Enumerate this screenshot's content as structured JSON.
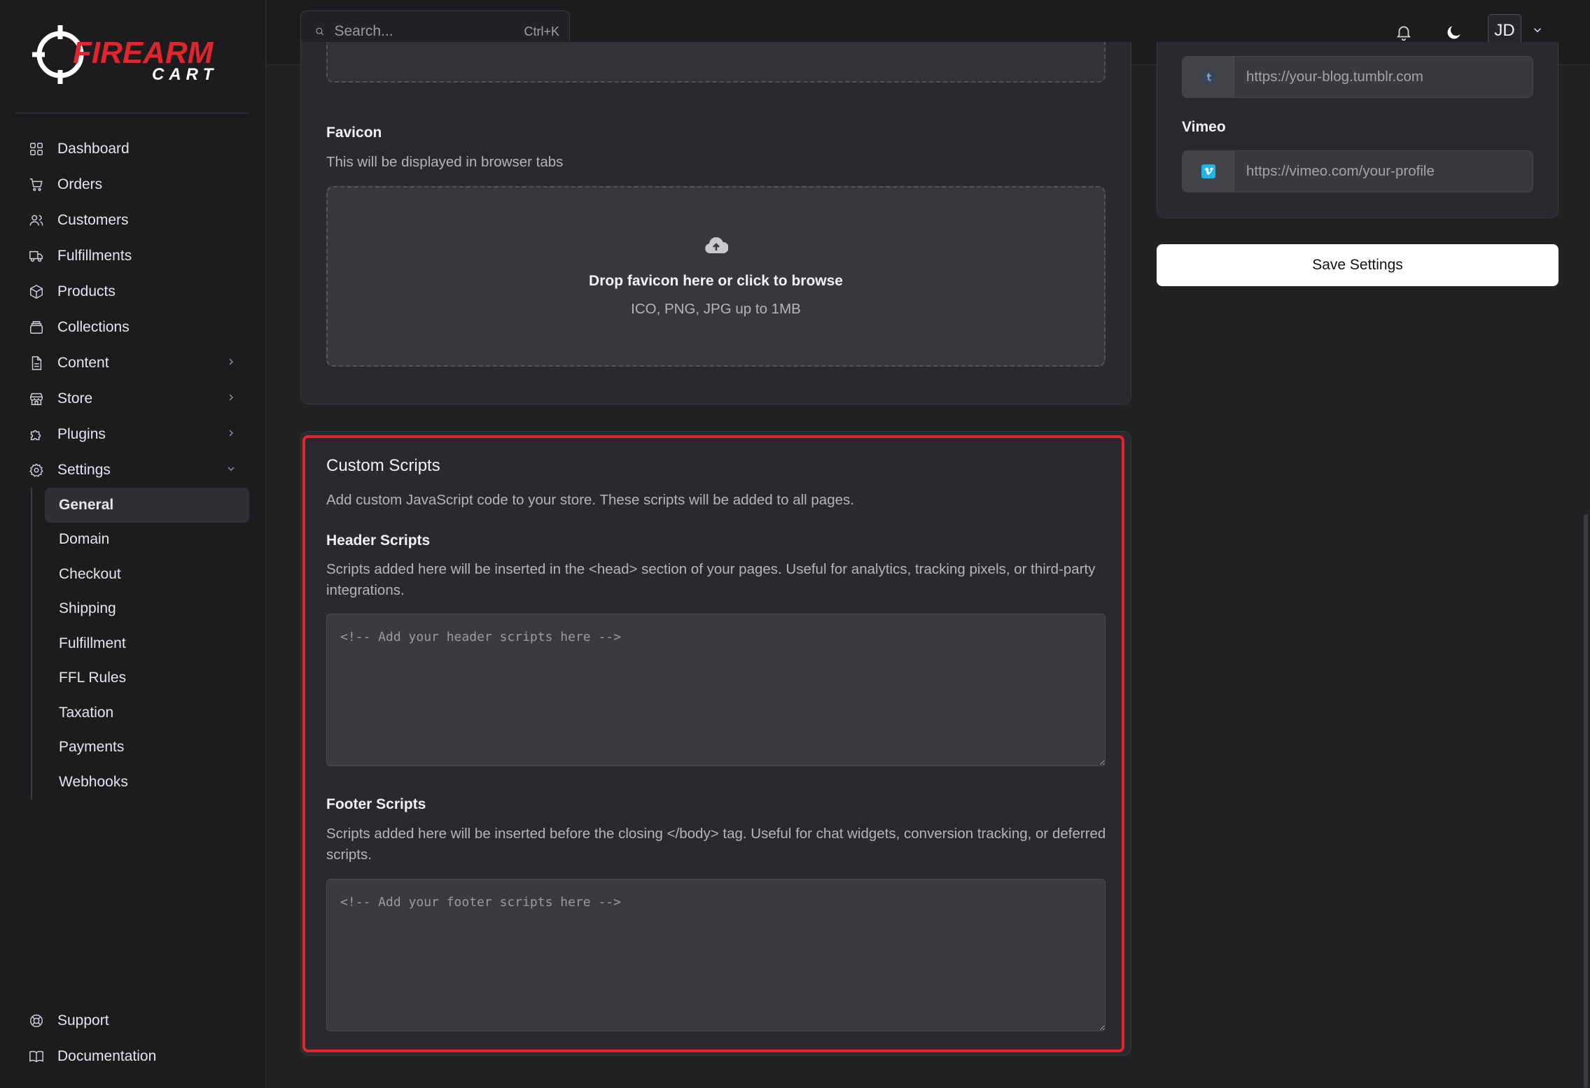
{
  "brand": {
    "line1": "FIREARM",
    "line2": "CART",
    "accent": "#e0252c"
  },
  "search": {
    "placeholder": "Search...",
    "shortcut": "Ctrl+K"
  },
  "header": {
    "avatar_initials": "JD"
  },
  "sidebar": {
    "items": [
      {
        "label": "Dashboard",
        "icon": "dashboard-icon"
      },
      {
        "label": "Orders",
        "icon": "cart-icon"
      },
      {
        "label": "Customers",
        "icon": "users-icon"
      },
      {
        "label": "Fulfillments",
        "icon": "truck-icon"
      },
      {
        "label": "Products",
        "icon": "box-icon"
      },
      {
        "label": "Collections",
        "icon": "collection-icon"
      },
      {
        "label": "Content",
        "icon": "file-icon"
      },
      {
        "label": "Store",
        "icon": "store-icon"
      },
      {
        "label": "Plugins",
        "icon": "puzzle-icon"
      },
      {
        "label": "Settings",
        "icon": "gear-icon"
      }
    ],
    "settings_sub": [
      "General",
      "Domain",
      "Checkout",
      "Shipping",
      "Fulfillment",
      "FFL Rules",
      "Taxation",
      "Payments",
      "Webhooks"
    ],
    "bottom": [
      {
        "label": "Support",
        "icon": "lifebuoy-icon"
      },
      {
        "label": "Documentation",
        "icon": "book-icon"
      }
    ]
  },
  "favicon": {
    "label": "Favicon",
    "help": "This will be displayed in browser tabs",
    "drop_title": "Drop favicon here or click to browse",
    "drop_sub": "ICO, PNG, JPG up to 1MB"
  },
  "scripts": {
    "title": "Custom Scripts",
    "description": "Add custom JavaScript code to your store. These scripts will be added to all pages.",
    "header_label": "Header Scripts",
    "header_help": "Scripts added here will be inserted in the <head> section of your pages. Useful for analytics, tracking pixels, or third-party integrations.",
    "header_placeholder": "<!-- Add your header scripts here -->",
    "footer_label": "Footer Scripts",
    "footer_help": "Scripts added here will be inserted before the closing </body> tag. Useful for chat widgets, conversion tracking, or deferred scripts.",
    "footer_placeholder": "<!-- Add your footer scripts here -->"
  },
  "social": {
    "tumblr_placeholder": "https://your-blog.tumblr.com",
    "vimeo_label": "Vimeo",
    "vimeo_placeholder": "https://vimeo.com/your-profile"
  },
  "actions": {
    "save_label": "Save Settings"
  }
}
